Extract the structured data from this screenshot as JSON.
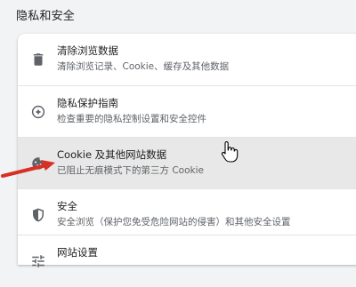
{
  "section": {
    "title": "隐私和安全"
  },
  "items": [
    {
      "title": "清除浏览数据",
      "subtitle": "清除浏览记录、Cookie、缓存及其他数据",
      "icon": "trash-icon"
    },
    {
      "title": "隐私保护指南",
      "subtitle": "检查重要的隐私控制设置和安全控件",
      "icon": "compass-icon"
    },
    {
      "title": "Cookie 及其他网站数据",
      "subtitle": "已阻止无痕模式下的第三方 Cookie",
      "icon": "cookie-icon",
      "hovered": true
    },
    {
      "title": "安全",
      "subtitle": "安全浏览（保护您免受危险网站的侵害）和其他安全设置",
      "icon": "shield-icon"
    },
    {
      "title": "网站设置",
      "subtitle": "",
      "icon": "sliders-icon"
    }
  ],
  "colors": {
    "background": "#f1f3f4",
    "card": "#ffffff",
    "hover": "#e8e8e8",
    "text_primary": "#202124",
    "text_secondary": "#5f6368",
    "annotation_arrow": "#d93025"
  }
}
